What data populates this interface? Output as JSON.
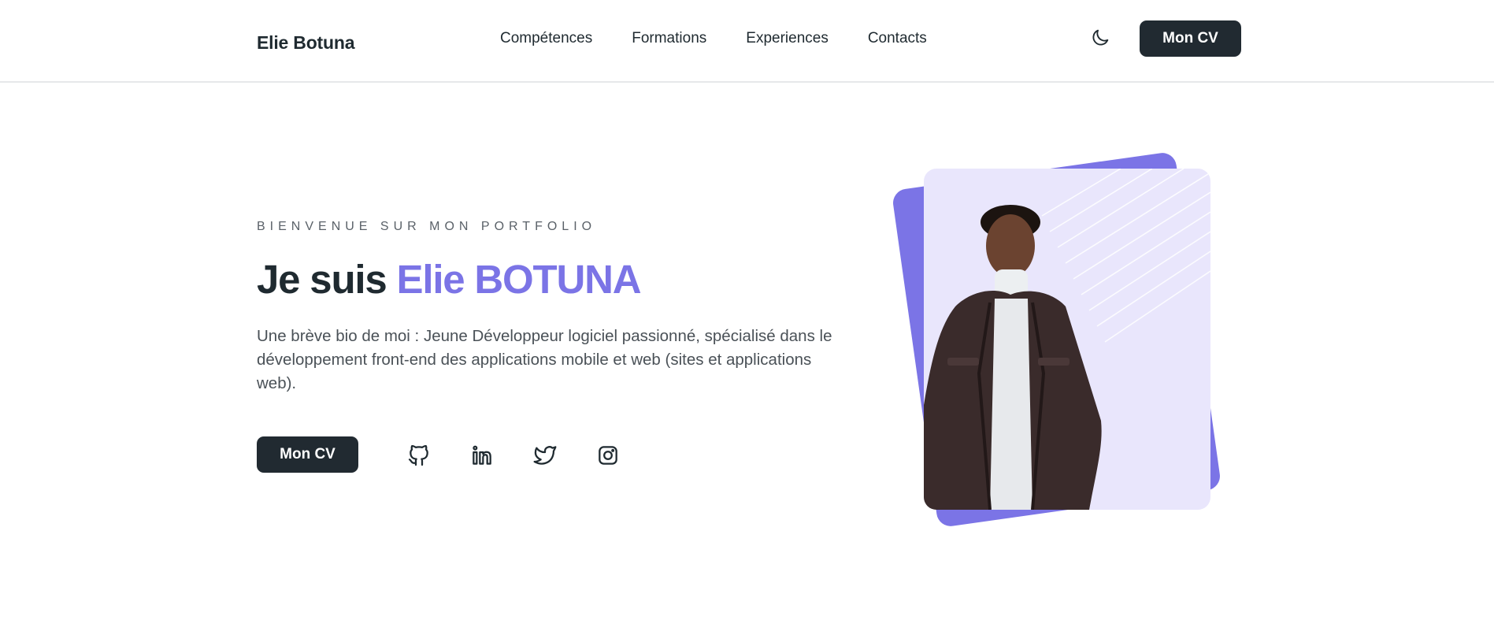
{
  "header": {
    "brand": "Elie Botuna",
    "nav": [
      "Compétences",
      "Formations",
      "Experiences",
      "Contacts"
    ],
    "theme_toggle_icon": "moon-icon",
    "cv_button": "Mon CV"
  },
  "hero": {
    "eyebrow": "BIENVENUE SUR MON PORTFOLIO",
    "headline_prefix": "Je suis ",
    "headline_name": "Elie BOTUNA",
    "bio": "Une brève bio de moi : Jeune Développeur logiciel passionné, spécialisé dans le développement front-end des applications mobile et web (sites et applications web).",
    "cv_button": "Mon CV",
    "socials": [
      "github-icon",
      "linkedin-icon",
      "twitter-icon",
      "instagram-icon"
    ]
  },
  "colors": {
    "accent": "#7b74e6",
    "dark": "#212a31",
    "card_bg": "#e9e6fc"
  }
}
